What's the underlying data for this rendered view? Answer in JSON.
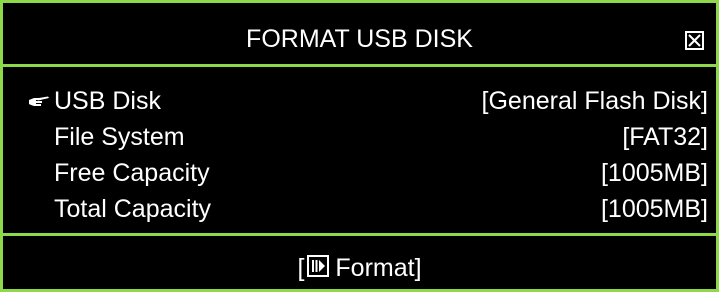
{
  "dialog": {
    "title": "FORMAT USB DISK",
    "close_icon": "close-box-icon"
  },
  "rows": [
    {
      "label": "USB Disk",
      "value": "[General Flash Disk]",
      "selected": true
    },
    {
      "label": "File System",
      "value": "[FAT32]",
      "selected": false
    },
    {
      "label": "Free Capacity",
      "value": "[1005MB]",
      "selected": false
    },
    {
      "label": "Total Capacity",
      "value": "[1005MB]",
      "selected": false
    }
  ],
  "footer": {
    "open_bracket": "[",
    "button_label": "Format]",
    "button_icon": "play-pause-key-icon"
  },
  "colors": {
    "border": "#8fd84a",
    "background": "#000000",
    "text": "#ffffff"
  }
}
